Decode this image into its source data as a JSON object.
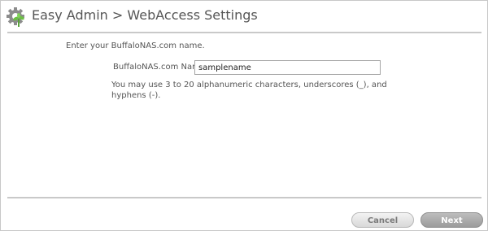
{
  "header": {
    "title": "Easy Admin > WebAccess Settings",
    "icon": "gear-with-plant-icon"
  },
  "form": {
    "intro": "Enter your BuffaloNAS.com name.",
    "field_label": "BuffaloNAS.com Name:",
    "field_value": "samplename",
    "hint": "You may use 3 to 20 alphanumeric characters, underscores (_), and hyphens (-)."
  },
  "footer": {
    "cancel_label": "Cancel",
    "next_label": "Next"
  },
  "colors": {
    "text": "#555555",
    "rule": "#c9c9c9",
    "next_button": "#a8a8a8",
    "cancel_button": "#e4e4e4"
  }
}
